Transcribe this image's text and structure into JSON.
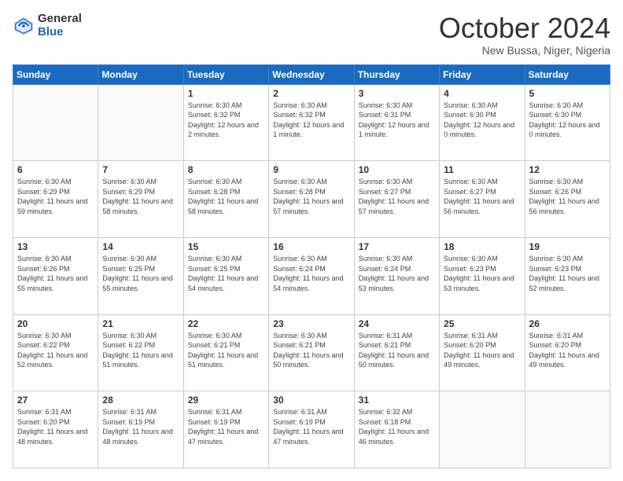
{
  "logo": {
    "general": "General",
    "blue": "Blue"
  },
  "header": {
    "month": "October 2024",
    "location": "New Bussa, Niger, Nigeria"
  },
  "weekdays": [
    "Sunday",
    "Monday",
    "Tuesday",
    "Wednesday",
    "Thursday",
    "Friday",
    "Saturday"
  ],
  "weeks": [
    [
      {
        "day": "",
        "sunrise": "",
        "sunset": "",
        "daylight": ""
      },
      {
        "day": "",
        "sunrise": "",
        "sunset": "",
        "daylight": ""
      },
      {
        "day": "1",
        "sunrise": "Sunrise: 6:30 AM",
        "sunset": "Sunset: 6:32 PM",
        "daylight": "Daylight: 12 hours and 2 minutes."
      },
      {
        "day": "2",
        "sunrise": "Sunrise: 6:30 AM",
        "sunset": "Sunset: 6:32 PM",
        "daylight": "Daylight: 12 hours and 1 minute."
      },
      {
        "day": "3",
        "sunrise": "Sunrise: 6:30 AM",
        "sunset": "Sunset: 6:31 PM",
        "daylight": "Daylight: 12 hours and 1 minute."
      },
      {
        "day": "4",
        "sunrise": "Sunrise: 6:30 AM",
        "sunset": "Sunset: 6:30 PM",
        "daylight": "Daylight: 12 hours and 0 minutes."
      },
      {
        "day": "5",
        "sunrise": "Sunrise: 6:30 AM",
        "sunset": "Sunset: 6:30 PM",
        "daylight": "Daylight: 12 hours and 0 minutes."
      }
    ],
    [
      {
        "day": "6",
        "sunrise": "Sunrise: 6:30 AM",
        "sunset": "Sunset: 6:29 PM",
        "daylight": "Daylight: 11 hours and 59 minutes."
      },
      {
        "day": "7",
        "sunrise": "Sunrise: 6:30 AM",
        "sunset": "Sunset: 6:29 PM",
        "daylight": "Daylight: 11 hours and 58 minutes."
      },
      {
        "day": "8",
        "sunrise": "Sunrise: 6:30 AM",
        "sunset": "Sunset: 6:28 PM",
        "daylight": "Daylight: 11 hours and 58 minutes."
      },
      {
        "day": "9",
        "sunrise": "Sunrise: 6:30 AM",
        "sunset": "Sunset: 6:28 PM",
        "daylight": "Daylight: 11 hours and 57 minutes."
      },
      {
        "day": "10",
        "sunrise": "Sunrise: 6:30 AM",
        "sunset": "Sunset: 6:27 PM",
        "daylight": "Daylight: 11 hours and 57 minutes."
      },
      {
        "day": "11",
        "sunrise": "Sunrise: 6:30 AM",
        "sunset": "Sunset: 6:27 PM",
        "daylight": "Daylight: 11 hours and 56 minutes."
      },
      {
        "day": "12",
        "sunrise": "Sunrise: 6:30 AM",
        "sunset": "Sunset: 6:26 PM",
        "daylight": "Daylight: 11 hours and 56 minutes."
      }
    ],
    [
      {
        "day": "13",
        "sunrise": "Sunrise: 6:30 AM",
        "sunset": "Sunset: 6:26 PM",
        "daylight": "Daylight: 11 hours and 55 minutes."
      },
      {
        "day": "14",
        "sunrise": "Sunrise: 6:30 AM",
        "sunset": "Sunset: 6:25 PM",
        "daylight": "Daylight: 11 hours and 55 minutes."
      },
      {
        "day": "15",
        "sunrise": "Sunrise: 6:30 AM",
        "sunset": "Sunset: 6:25 PM",
        "daylight": "Daylight: 11 hours and 54 minutes."
      },
      {
        "day": "16",
        "sunrise": "Sunrise: 6:30 AM",
        "sunset": "Sunset: 6:24 PM",
        "daylight": "Daylight: 11 hours and 54 minutes."
      },
      {
        "day": "17",
        "sunrise": "Sunrise: 6:30 AM",
        "sunset": "Sunset: 6:24 PM",
        "daylight": "Daylight: 11 hours and 53 minutes."
      },
      {
        "day": "18",
        "sunrise": "Sunrise: 6:30 AM",
        "sunset": "Sunset: 6:23 PM",
        "daylight": "Daylight: 11 hours and 53 minutes."
      },
      {
        "day": "19",
        "sunrise": "Sunrise: 6:30 AM",
        "sunset": "Sunset: 6:23 PM",
        "daylight": "Daylight: 11 hours and 52 minutes."
      }
    ],
    [
      {
        "day": "20",
        "sunrise": "Sunrise: 6:30 AM",
        "sunset": "Sunset: 6:22 PM",
        "daylight": "Daylight: 11 hours and 52 minutes."
      },
      {
        "day": "21",
        "sunrise": "Sunrise: 6:30 AM",
        "sunset": "Sunset: 6:22 PM",
        "daylight": "Daylight: 11 hours and 51 minutes."
      },
      {
        "day": "22",
        "sunrise": "Sunrise: 6:30 AM",
        "sunset": "Sunset: 6:21 PM",
        "daylight": "Daylight: 11 hours and 51 minutes."
      },
      {
        "day": "23",
        "sunrise": "Sunrise: 6:30 AM",
        "sunset": "Sunset: 6:21 PM",
        "daylight": "Daylight: 11 hours and 50 minutes."
      },
      {
        "day": "24",
        "sunrise": "Sunrise: 6:31 AM",
        "sunset": "Sunset: 6:21 PM",
        "daylight": "Daylight: 11 hours and 50 minutes."
      },
      {
        "day": "25",
        "sunrise": "Sunrise: 6:31 AM",
        "sunset": "Sunset: 6:20 PM",
        "daylight": "Daylight: 11 hours and 49 minutes."
      },
      {
        "day": "26",
        "sunrise": "Sunrise: 6:31 AM",
        "sunset": "Sunset: 6:20 PM",
        "daylight": "Daylight: 11 hours and 49 minutes."
      }
    ],
    [
      {
        "day": "27",
        "sunrise": "Sunrise: 6:31 AM",
        "sunset": "Sunset: 6:20 PM",
        "daylight": "Daylight: 11 hours and 48 minutes."
      },
      {
        "day": "28",
        "sunrise": "Sunrise: 6:31 AM",
        "sunset": "Sunset: 6:19 PM",
        "daylight": "Daylight: 11 hours and 48 minutes."
      },
      {
        "day": "29",
        "sunrise": "Sunrise: 6:31 AM",
        "sunset": "Sunset: 6:19 PM",
        "daylight": "Daylight: 11 hours and 47 minutes."
      },
      {
        "day": "30",
        "sunrise": "Sunrise: 6:31 AM",
        "sunset": "Sunset: 6:19 PM",
        "daylight": "Daylight: 11 hours and 47 minutes."
      },
      {
        "day": "31",
        "sunrise": "Sunrise: 6:32 AM",
        "sunset": "Sunset: 6:18 PM",
        "daylight": "Daylight: 11 hours and 46 minutes."
      },
      {
        "day": "",
        "sunrise": "",
        "sunset": "",
        "daylight": ""
      },
      {
        "day": "",
        "sunrise": "",
        "sunset": "",
        "daylight": ""
      }
    ]
  ]
}
